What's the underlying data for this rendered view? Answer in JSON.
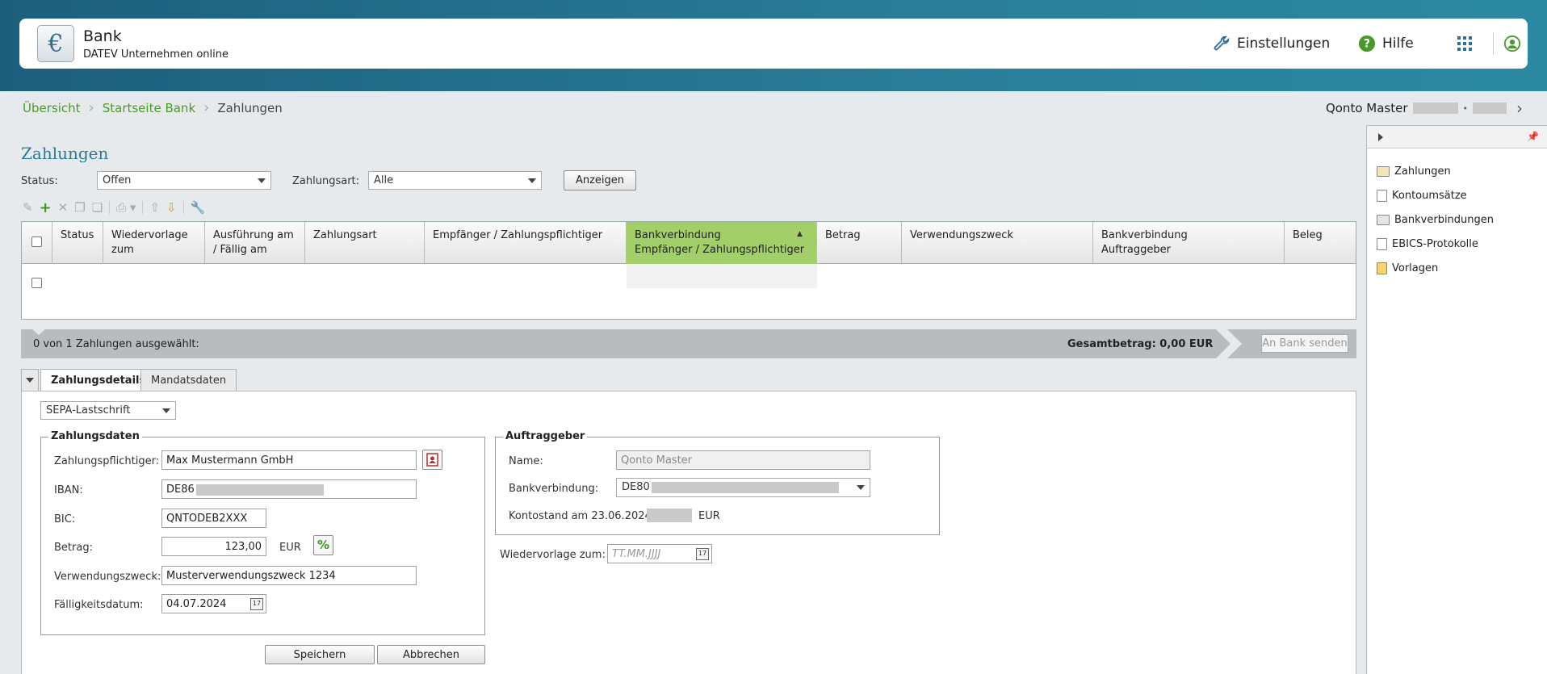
{
  "header": {
    "app_title": "Bank",
    "app_subtitle": "DATEV Unternehmen online",
    "logo_symbol": "€",
    "settings_label": "Einstellungen",
    "help_label": "Hilfe"
  },
  "breadcrumb": {
    "items": [
      "Übersicht",
      "Startseite Bank",
      "Zahlungen"
    ]
  },
  "mandant": {
    "name": "Qonto Master"
  },
  "page": {
    "title": "Zahlungen"
  },
  "filters": {
    "status_label": "Status:",
    "status_value": "Offen",
    "type_label": "Zahlungsart:",
    "type_value": "Alle",
    "show_button": "Anzeigen"
  },
  "grid": {
    "columns": [
      "Status",
      "Wiedervorlage\nzum",
      "Ausführung am\n/ Fällig am",
      "Zahlungsart",
      "Empfänger / Zahlungspflichtiger",
      "Bankverbindung\nEmpfänger / Zahlungspflichtiger",
      "Betrag",
      "Verwendungszweck",
      "Bankverbindung\nAuftraggeber",
      "Beleg"
    ],
    "sorted_column": "Bankverbindung Empfänger / Zahlungspflichtiger",
    "sort_direction": "ascending"
  },
  "statusbar": {
    "selection_text": "0 von 1 Zahlungen ausgewählt:",
    "total_text": "Gesamtbetrag: 0,00 EUR",
    "send_button": "An Bank senden"
  },
  "tabs": {
    "details": "Zahlungsdetails",
    "mandate": "Mandatsdaten"
  },
  "details": {
    "payment_type": "SEPA-Lastschrift",
    "zahlungsdaten_legend": "Zahlungsdaten",
    "payer_label": "Zahlungspflichtiger:",
    "payer_value": "Max Mustermann GmbH",
    "iban_label": "IBAN:",
    "iban_value": "DE86",
    "bic_label": "BIC:",
    "bic_value": "QNTODEB2XXX",
    "amount_label": "Betrag:",
    "amount_value": "123,00",
    "currency": "EUR",
    "purpose_label": "Verwendungszweck:",
    "purpose_value": "Musterverwendungszweck 1234",
    "due_label": "Fälligkeitsdatum:",
    "due_value": "04.07.2024",
    "auftraggeber_legend": "Auftraggeber",
    "name_label": "Name:",
    "name_value": "Qonto Master",
    "bank_label": "Bankverbindung:",
    "bank_value": "DE80",
    "balance_label": "Kontostand am 23.06.2024:",
    "balance_currency": "EUR",
    "resubmit_label": "Wiedervorlage zum:",
    "resubmit_placeholder": "TT.MM.JJJJ",
    "save_button": "Speichern",
    "cancel_button": "Abbrechen"
  },
  "sidebar": {
    "items": [
      "Zahlungen",
      "Kontoumsätze",
      "Bankverbindungen",
      "EBICS-Protokolle",
      "Vorlagen"
    ]
  },
  "colors": {
    "accent_green": "#4a9a2b",
    "title_teal": "#2c7a96",
    "sorted_column_bg": "#a3cf68",
    "header_gradient_start": "#1c5f7d"
  }
}
